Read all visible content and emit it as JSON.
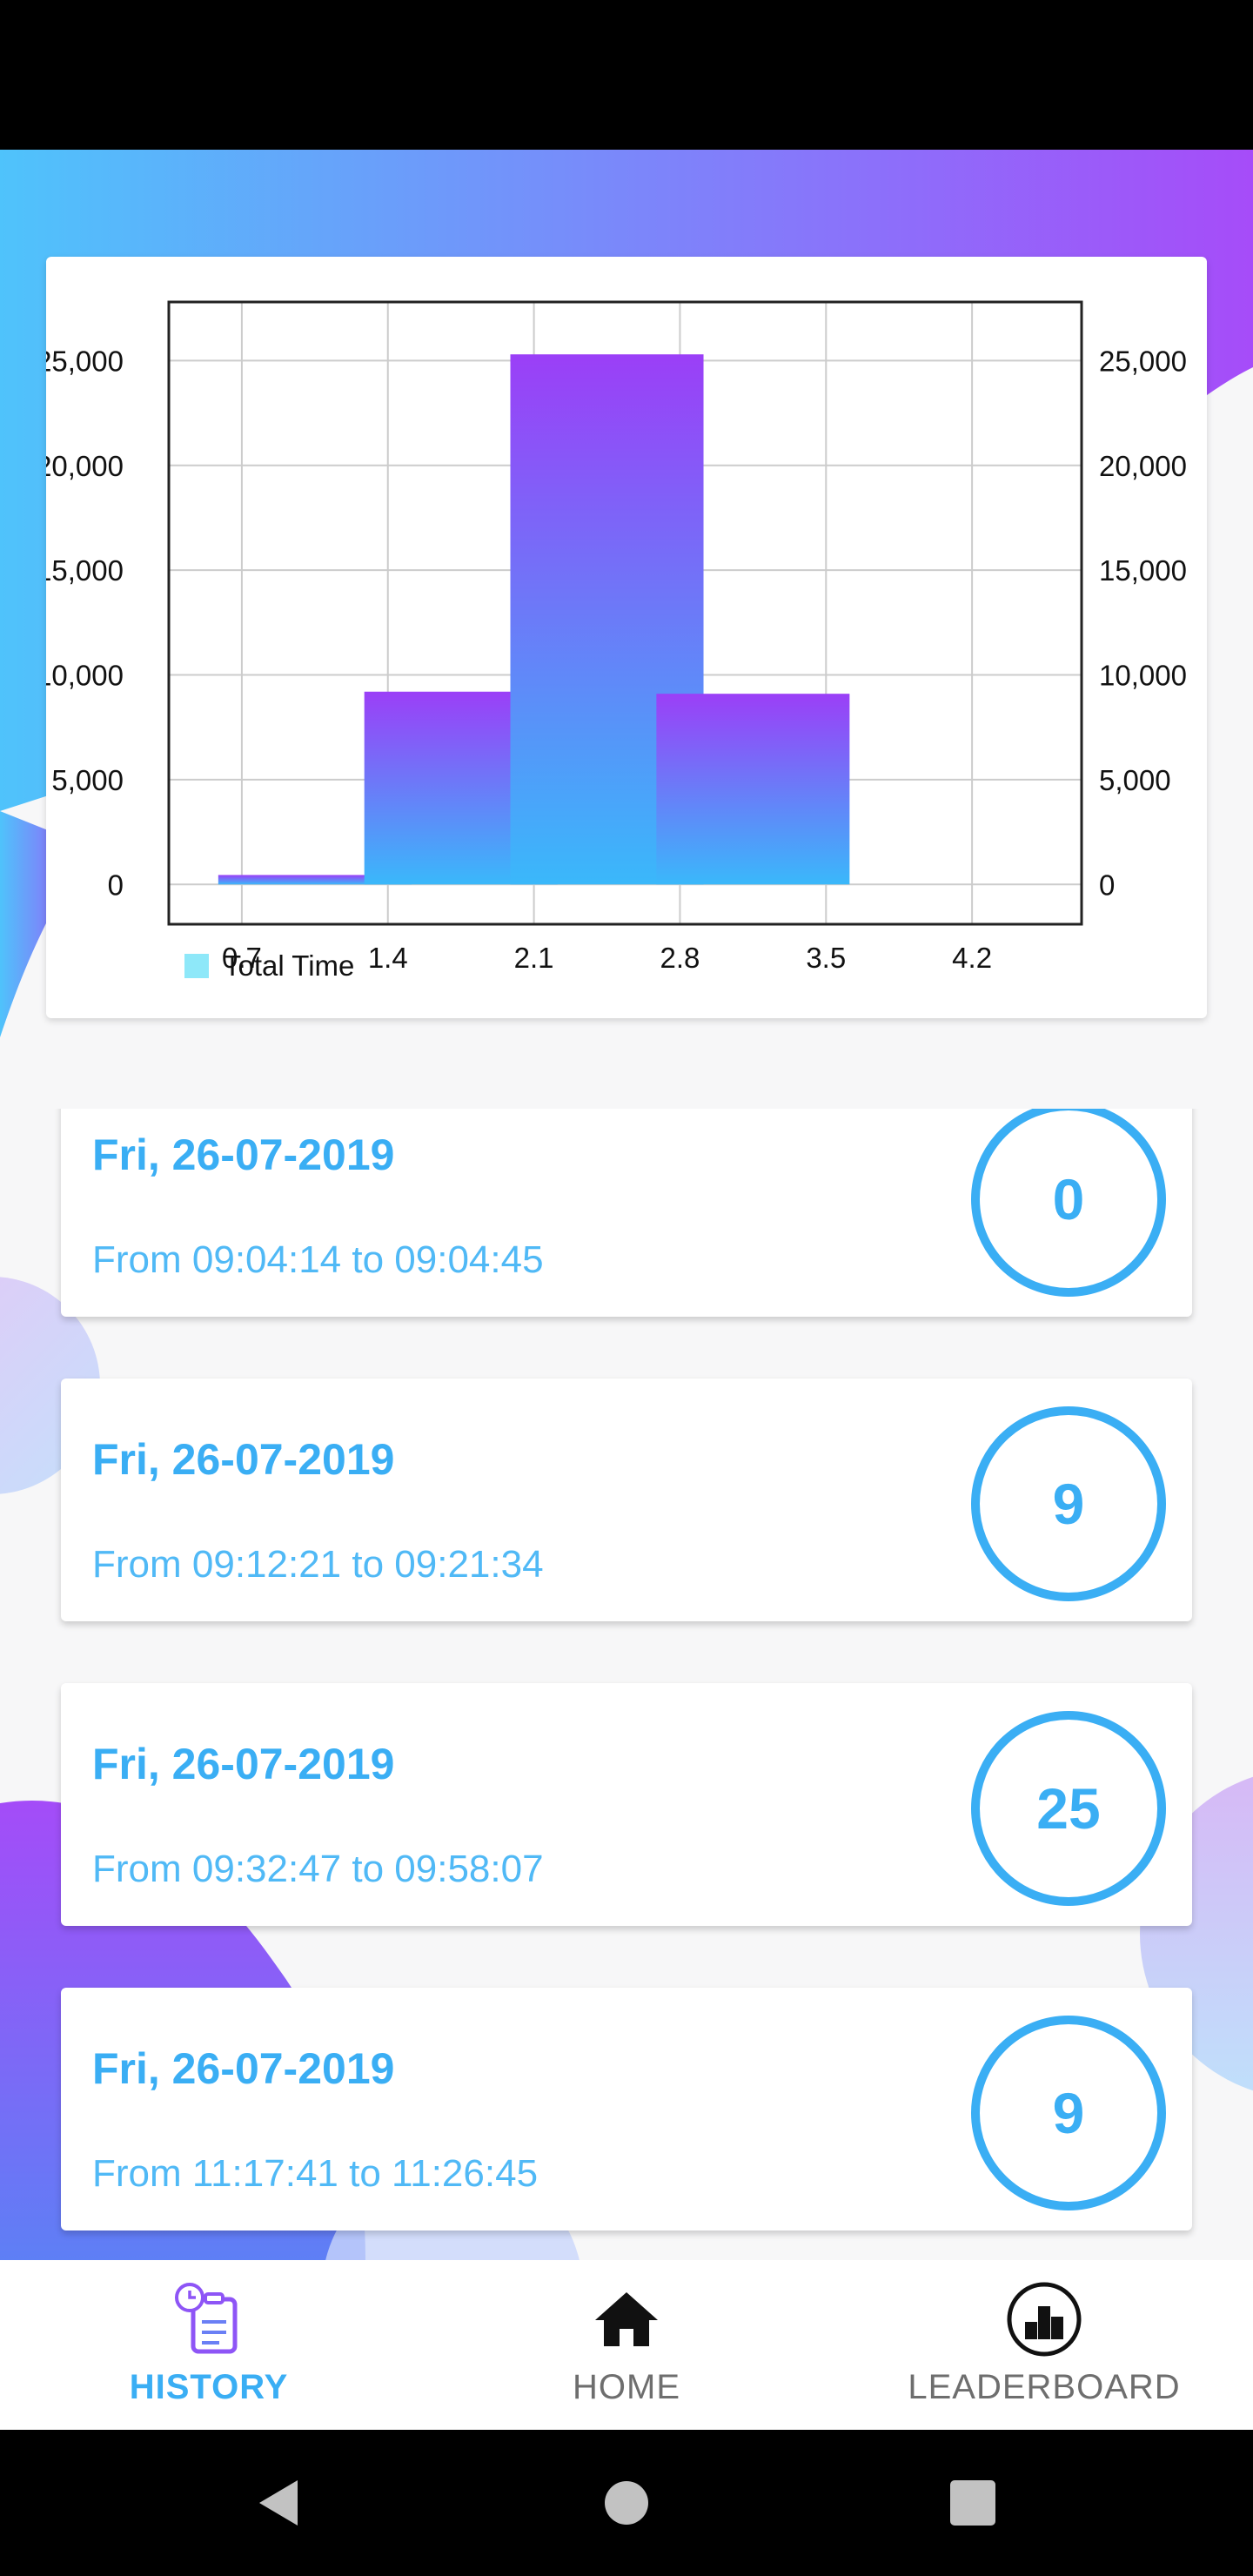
{
  "chart_data": {
    "type": "bar",
    "categories": [
      "0.7",
      "1.4",
      "2.1",
      "2.8",
      "3.5",
      "4.2"
    ],
    "bars": [
      {
        "x": 1,
        "value": 450
      },
      {
        "x": 2,
        "value": 9200
      },
      {
        "x": 3,
        "value": 25300
      },
      {
        "x": 4,
        "value": 9100
      }
    ],
    "y_ticks": [
      "0",
      "5,000",
      "10,000",
      "15,000",
      "20,000",
      "25,000"
    ],
    "y_tick_values": [
      0,
      5000,
      10000,
      15000,
      20000,
      25000
    ],
    "ylim": [
      -1900,
      27800
    ],
    "legend": "Total Time",
    "legend_position": "bottom-left",
    "grid": true,
    "colors": {
      "bar_top": "#9b3ff7",
      "bar_bottom": "#3ab8fa",
      "legend_swatch": "#8ee8f9"
    }
  },
  "sessions": [
    {
      "date": "Fri, 26-07-2019",
      "time": "From 09:04:14 to 09:04:45",
      "score": "0"
    },
    {
      "date": "Fri, 26-07-2019",
      "time": "From 09:12:21 to 09:21:34",
      "score": "9"
    },
    {
      "date": "Fri, 26-07-2019",
      "time": "From 09:32:47 to 09:58:07",
      "score": "25"
    },
    {
      "date": "Fri, 26-07-2019",
      "time": "From 11:17:41 to 11:26:45",
      "score": "9"
    }
  ],
  "nav": {
    "history": {
      "label": "HISTORY",
      "icon": "history-icon",
      "active": true
    },
    "home": {
      "label": "HOME",
      "icon": "home-icon",
      "active": false
    },
    "leaderboard": {
      "label": "LEADERBOARD",
      "icon": "leaderboard-icon",
      "active": false
    }
  },
  "colors": {
    "accent": "#3aaef4",
    "gradient_start": "#4fc3fb",
    "gradient_end": "#a64cf9",
    "nav_inactive": "#6e6e6e"
  }
}
